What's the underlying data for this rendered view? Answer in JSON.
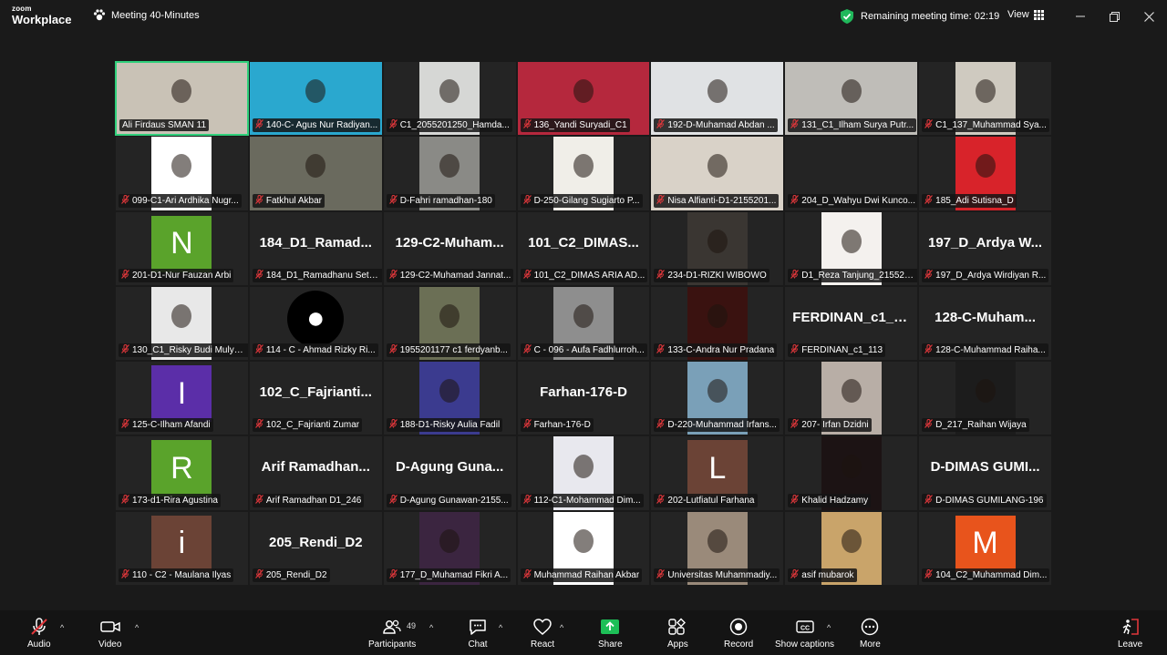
{
  "app": {
    "brand_small": "zoom",
    "brand_large": "Workplace",
    "meeting_title": "Meeting 40-Minutes"
  },
  "header": {
    "remaining": "Remaining meeting time: 02:19",
    "view_label": "View"
  },
  "colors": {
    "accent_green": "#2fd07b",
    "mic_muted": "#e0373b",
    "share_green": "#1dbf57"
  },
  "tiles": [
    {
      "name": "Ali Firdaus SMAN 11",
      "type": "video",
      "bg": "#c9c2b6",
      "wide": true,
      "active": true,
      "muted": false
    },
    {
      "name": "140-C- Agus Nur Radiyan...",
      "type": "video",
      "bg": "#2aa8cf",
      "wide": true,
      "muted": true
    },
    {
      "name": "C1_2055201250_Hamda...",
      "type": "video",
      "bg": "#d6d7d5",
      "muted": true
    },
    {
      "name": "136_Yandi Suryadi_C1",
      "type": "video",
      "bg": "#b5283d",
      "wide": true,
      "muted": true
    },
    {
      "name": "192-D-Muhamad Abdan ...",
      "type": "video",
      "bg": "#e0e2e4",
      "wide": true,
      "muted": true
    },
    {
      "name": "131_C1_Ilham Surya Putr...",
      "type": "video",
      "bg": "#bfbdb8",
      "wide": true,
      "muted": true
    },
    {
      "name": "C1_137_Muhammad Sya...",
      "type": "video",
      "bg": "#cfcac0",
      "muted": true
    },
    {
      "name": "099-C1-Ari Ardhika Nugr...",
      "type": "video",
      "bg": "#ffffff",
      "muted": true
    },
    {
      "name": "Fatkhul Akbar",
      "type": "video",
      "bg": "#6a6a5e",
      "wide": true,
      "muted": true
    },
    {
      "name": "D-Fahri ramadhan-180",
      "type": "video",
      "bg": "#8a8a86",
      "muted": true
    },
    {
      "name": "D-250-Gilang Sugiarto P...",
      "type": "video",
      "bg": "#f0eee8",
      "muted": true
    },
    {
      "name": "Nisa Alfianti-D1-2155201...",
      "type": "video",
      "bg": "#d9d2c8",
      "wide": true,
      "muted": true
    },
    {
      "name": "204_D_Wahyu Dwi Kunco...",
      "type": "empty",
      "muted": true
    },
    {
      "name": "185_Adi Sutisna_D",
      "type": "video",
      "bg": "#d8232a",
      "muted": true
    },
    {
      "name": "201-D1-Nur Fauzan Arbi",
      "type": "avatar",
      "letter": "N",
      "bg": "#5aa32b",
      "muted": true
    },
    {
      "name": "184_D1_Ramadhanu Sety...",
      "type": "text",
      "big": "184_D1_Ramad...",
      "muted": true
    },
    {
      "name": "129-C2-Muhamad Jannat...",
      "type": "text",
      "big": "129-C2-Muham...",
      "muted": true
    },
    {
      "name": "101_C2_DIMAS ARIA AD...",
      "type": "text",
      "big": "101_C2_DIMAS...",
      "muted": true
    },
    {
      "name": "234-D1-RIZKI WIBOWO",
      "type": "video",
      "bg": "#3a3632",
      "muted": true
    },
    {
      "name": "D1_Reza Tanjung_215520...",
      "type": "video",
      "bg": "#f4f1ee",
      "muted": true
    },
    {
      "name": "197_D_Ardya Wirdiyan R...",
      "type": "text",
      "big": "197_D_Ardya W...",
      "muted": true
    },
    {
      "name": "130_C1_Risky Budi Mulya...",
      "type": "video",
      "bg": "#e8e8e8",
      "muted": true
    },
    {
      "name": "114 - C - Ahmad Rizky Ri...",
      "type": "avatar",
      "letter": "●",
      "bg": "#000000",
      "round": true,
      "muted": true
    },
    {
      "name": "1955201177 c1 ferdyanb...",
      "type": "video",
      "bg": "#6b6f55",
      "muted": true
    },
    {
      "name": "C - 096 - Aufa Fadhlurroh...",
      "type": "video",
      "bg": "#8e8e8e",
      "muted": true
    },
    {
      "name": "133-C-Andra Nur Pradana",
      "type": "video",
      "bg": "#3a1210",
      "muted": true
    },
    {
      "name": "FERDINAN_c1_113",
      "type": "text",
      "big": "FERDINAN_c1_1...",
      "muted": true
    },
    {
      "name": "128-C-Muhammad Raiha...",
      "type": "text",
      "big": "128-C-Muham...",
      "muted": true
    },
    {
      "name": "125-C-Ilham Afandi",
      "type": "avatar",
      "letter": "I",
      "bg": "#5b2ea8",
      "muted": true
    },
    {
      "name": "102_C_Fajrianti Zumar",
      "type": "text",
      "big": "102_C_Fajrianti...",
      "muted": true
    },
    {
      "name": "188-D1-Risky Aulia Fadil",
      "type": "video",
      "bg": "#3b3b8f",
      "muted": true
    },
    {
      "name": "Farhan-176-D",
      "type": "text",
      "big": "Farhan-176-D",
      "muted": true
    },
    {
      "name": "D-220-Muhammad Irfans...",
      "type": "video",
      "bg": "#7aa0b8",
      "muted": true
    },
    {
      "name": "207- Irfan Dzidni",
      "type": "video",
      "bg": "#b8aea6",
      "muted": true
    },
    {
      "name": "D_217_Raihan Wijaya",
      "type": "video",
      "bg": "#1c1c1c",
      "muted": true
    },
    {
      "name": "173-d1-Rira Agustina",
      "type": "avatar",
      "letter": "R",
      "bg": "#5aa32b",
      "muted": true
    },
    {
      "name": "Arif Ramadhan D1_246",
      "type": "text",
      "big": "Arif Ramadhan...",
      "muted": true
    },
    {
      "name": "D-Agung Gunawan-2155...",
      "type": "text",
      "big": "D-Agung Guna...",
      "muted": true
    },
    {
      "name": "112-C1-Mohammad Dim...",
      "type": "video",
      "bg": "#e8e8ee",
      "muted": true
    },
    {
      "name": "202-Lutfiatul Farhana",
      "type": "avatar",
      "letter": "L",
      "bg": "#6b4336",
      "muted": true
    },
    {
      "name": "Khalid Hadzamy",
      "type": "video",
      "bg": "#1c1314",
      "muted": true
    },
    {
      "name": "D-DIMAS GUMILANG-196",
      "type": "text",
      "big": "D-DIMAS GUMI...",
      "muted": true
    },
    {
      "name": "110 - C2 - Maulana Ilyas",
      "type": "avatar",
      "letter": "i",
      "bg": "#6b4336",
      "muted": true
    },
    {
      "name": "205_Rendi_D2",
      "type": "text",
      "big": "205_Rendi_D2",
      "muted": true
    },
    {
      "name": "177_D_Muhamad Fikri A...",
      "type": "video",
      "bg": "#3b2540",
      "muted": true
    },
    {
      "name": "Muhammad Raihan Akbar",
      "type": "video",
      "bg": "#ffffff",
      "muted": true
    },
    {
      "name": "Universitas Muhammadiy...",
      "type": "video",
      "bg": "#9a8a7a",
      "muted": true
    },
    {
      "name": "asif mubarok",
      "type": "video",
      "bg": "#c9a46a",
      "muted": true
    },
    {
      "name": "104_C2_Muhammad Dim...",
      "type": "avatar",
      "letter": "M",
      "bg": "#e8541c",
      "muted": true
    }
  ],
  "toolbar": {
    "audio": "Audio",
    "video": "Video",
    "participants": "Participants",
    "participants_count": "49",
    "chat": "Chat",
    "react": "React",
    "share": "Share",
    "apps": "Apps",
    "record": "Record",
    "captions": "Show captions",
    "more": "More",
    "leave": "Leave"
  }
}
